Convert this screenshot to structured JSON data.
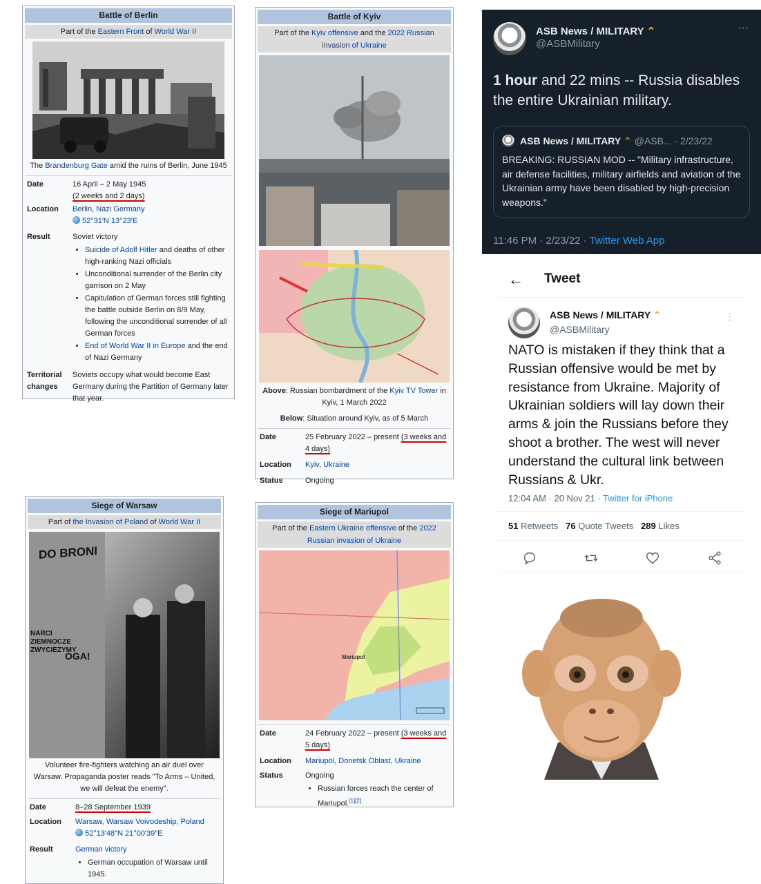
{
  "berlin": {
    "title": "Battle of Berlin",
    "sub_prefix": "Part of the ",
    "sub_link1": "Eastern Front",
    "sub_mid": " of ",
    "sub_link2": "World War II",
    "caption_pre": "The ",
    "caption_link": "Brandenburg Gate",
    "caption_post": " amid the ruins of Berlin, June 1945",
    "date_label": "Date",
    "date_line1": "16 April – 2 May 1945",
    "date_line2": "(2 weeks and 2 days)",
    "location_label": "Location",
    "location_link": "Berlin, Nazi Germany",
    "coords": "52°31′N 13°23′E",
    "result_label": "Result",
    "result_text": "Soviet victory",
    "results": [
      {
        "link": "Suicide of Adolf Hitler",
        "text": " and deaths of other high-ranking Nazi officials"
      },
      {
        "link": "",
        "text": "Unconditional surrender of the Berlin city garrison on 2 May"
      },
      {
        "link": "",
        "text": "Capitulation of German forces still fighting the battle outside Berlin on 8/9 May, following the unconditional surrender of all German forces"
      },
      {
        "link": "End of World War II in Europe",
        "text": " and the end of Nazi Germany"
      }
    ],
    "territorial_label": "Territorial changes",
    "territorial_text": "Soviets occupy what would become East Germany during the Partition of Germany later that year."
  },
  "kyiv": {
    "title": "Battle of Kyiv",
    "sub_prefix": "Part of the ",
    "sub_link1": "Kyiv offensive",
    "sub_mid": " and the ",
    "sub_link2": "2022 Russian invasion of Ukraine",
    "above_label": "Above",
    "above_text": ": Russian bombardment of the ",
    "above_link": "Kyiv TV Tower",
    "above_post": " in Kyiv, 1 March 2022",
    "below_label": "Below",
    "below_text": ": Situation around Kyiv, as of 5 March",
    "date_label": "Date",
    "date_text": "25 February 2022 – present ",
    "date_paren": "(3 weeks and 4 days)",
    "location_label": "Location",
    "location_link": "Kyiv, Ukraine",
    "status_label": "Status",
    "status_text": "Ongoing"
  },
  "warsaw": {
    "title": "Siege of Warsaw",
    "sub_prefix": "Part of ",
    "sub_link1": "the Invasion of Poland",
    "sub_mid": " of ",
    "sub_link2": "World War II",
    "poster_text1": "DO BRONI",
    "poster_text2": "NARCI",
    "poster_text3": "ZIEMNOCZE",
    "poster_text4": "ZWYCIEZYMY",
    "poster_text5": "OGA!",
    "caption": "Volunteer fire-fighters watching an air duel over Warsaw. Propaganda poster reads \"To Arms – United, we will defeat the enemy\".",
    "date_label": "Date",
    "date_text": "8–28 September 1939",
    "location_label": "Location",
    "location_link": "Warsaw, Warsaw Voivodeship, Poland",
    "coords": "52°13′48″N 21°00′39″E",
    "result_label": "Result",
    "result_link": "German victory",
    "result_bullet": "German occupation of Warsaw until 1945."
  },
  "mariupol": {
    "title": "Siege of Mariupol",
    "sub_prefix": "Part of the ",
    "sub_link1": "Eastern Ukraine offensive",
    "sub_mid": " of the ",
    "sub_link2": "2022 Russian invasion of Ukraine",
    "map_city": "Mariupol",
    "date_label": "Date",
    "date_text": "24 February 2022 – present ",
    "date_paren": "(3 weeks and 5 days)",
    "location_label": "Location",
    "location_link": "Mariupol, Donetsk Oblast, Ukraine",
    "status_label": "Status",
    "status_text": "Ongoing",
    "status_bullet": "Russian forces reach the center of Mariupol.",
    "refs": "[1][2]"
  },
  "tweet1": {
    "name": "ASB News / MILITARY",
    "handle": "@ASBMilitary",
    "more": "···",
    "body_strong1": "1 hour",
    "body_rest": " and 22 mins -- Russia disables the entire Ukrainian military.",
    "quote_name": "ASB News / MILITARY",
    "quote_meta": "@ASB... · 2/23/22",
    "quote_text": "BREAKING: RUSSIAN MOD -- \"Military infrastructure, air defense facilities, military airfields and aviation of the Ukrainian army have been disabled by high-precision weapons.\"",
    "time": "11:46 PM · 2/23/22 · ",
    "app": "Twitter Web App"
  },
  "tweet2": {
    "header": "Tweet",
    "name": "ASB News / MILITARY",
    "handle": "@ASBMilitary",
    "more": "⋮",
    "body": "NATO is mistaken if they think that a Russian offensive would be met by resistance from Ukraine. Majority of Ukrainian soldiers will lay down their arms & join the Russians before they shoot a brother. The west will never understand the cultural link between Russians & Ukr.",
    "time": "12:04 AM · 20 Nov 21 · ",
    "app": "Twitter for iPhone",
    "retweets_count": "51",
    "retweets_label": "Retweets",
    "quotes_count": "76",
    "quotes_label": "Quote Tweets",
    "likes_count": "289",
    "likes_label": "Likes",
    "accent": "#1d9bf0"
  }
}
